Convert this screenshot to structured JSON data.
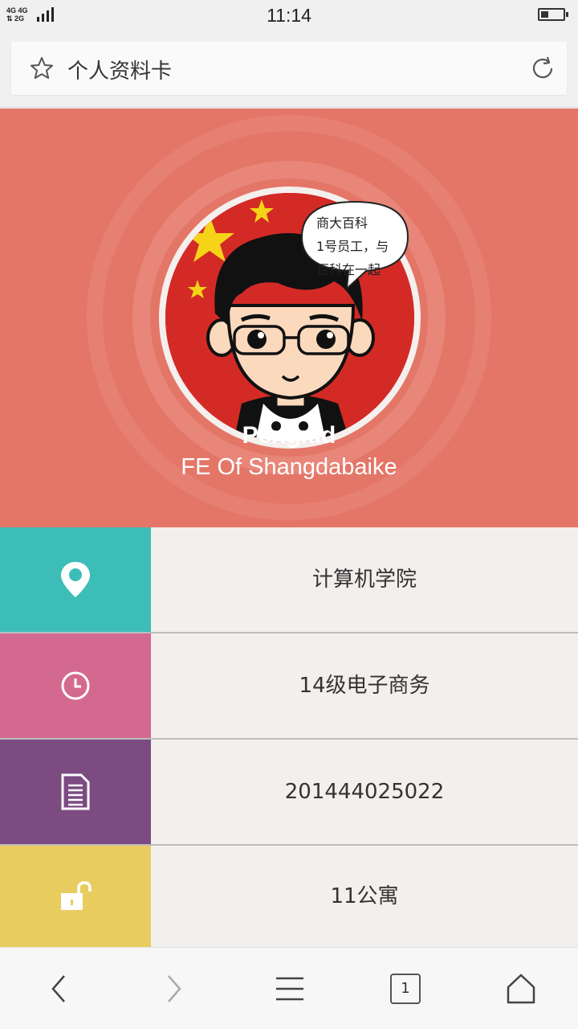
{
  "status_bar": {
    "network_top": "4G 4G",
    "network_bottom": "2G",
    "time": "11:14",
    "battery_level": 0.35
  },
  "browser": {
    "page_title": "个人资料卡",
    "bookmark_icon": "star-icon",
    "reload_icon": "refresh-icon"
  },
  "profile": {
    "name": "Pengxid",
    "role": "FE Of Shangdabaike",
    "speech_bubble": [
      "商大百科",
      "1号员工，与",
      "百科在一起"
    ],
    "hero_color": "#e47667"
  },
  "info_rows": [
    {
      "icon": "location-pin-icon",
      "color": "#3dbdb8",
      "text": "计算机学院"
    },
    {
      "icon": "clock-icon",
      "color": "#d4698f",
      "text": "14级电子商务"
    },
    {
      "icon": "document-icon",
      "color": "#7b4b82",
      "text": "201444025022"
    },
    {
      "icon": "unlock-icon",
      "color": "#e8cc5e",
      "text": "11公寓"
    }
  ],
  "bottom_nav": {
    "tab_count": "1",
    "items": [
      "back-icon",
      "forward-icon",
      "menu-icon",
      "tabs-icon",
      "home-icon"
    ]
  }
}
